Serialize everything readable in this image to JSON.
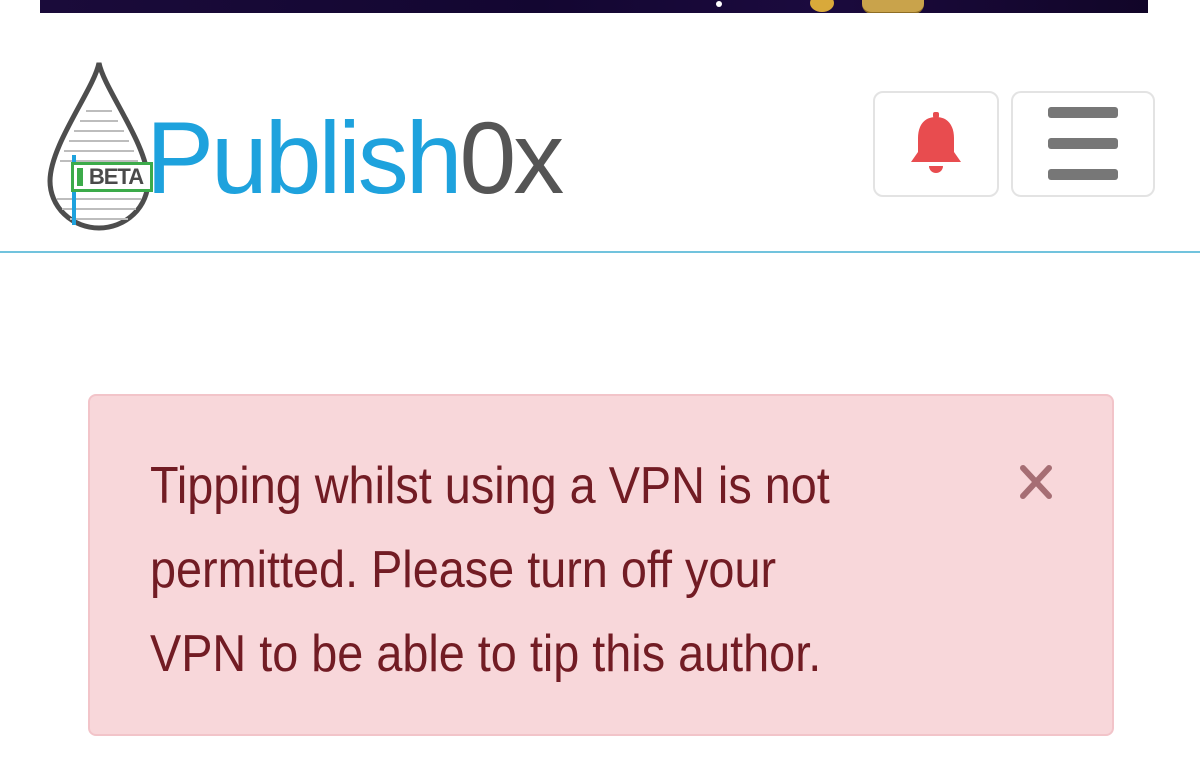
{
  "header": {
    "logo": {
      "badge": "BETA",
      "name_part1": "Publish",
      "name_part2": "0x"
    },
    "notifications_icon": "bell-icon",
    "menu_icon": "hamburger-menu-icon"
  },
  "alert": {
    "message": "Tipping whilst using a VPN is not permitted. Please turn off your VPN to be able to tip this author.",
    "close_icon": "close-icon"
  },
  "colors": {
    "brand_blue": "#1ea2dd",
    "brand_green": "#3cab4a",
    "bell_red": "#e84c4f",
    "alert_background": "#f8d7da",
    "alert_text": "#721c24",
    "header_divider": "#71c3dd"
  }
}
